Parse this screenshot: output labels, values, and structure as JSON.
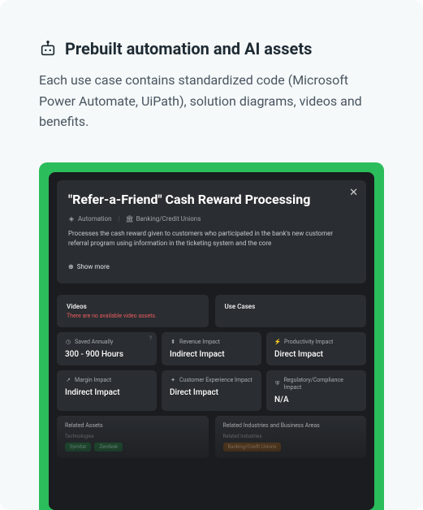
{
  "header": {
    "title": "Prebuilt automation and AI assets",
    "description": "Each use case contains standardized code (Microsoft Power Automate, UiPath), solution diagrams, videos and benefits."
  },
  "panel": {
    "title": "\"Refer-a-Friend\" Cash Reward Processing",
    "meta": {
      "category": "Automation",
      "industry": "Banking/Credit Unions"
    },
    "description": "Processes the cash reward given to customers who participated in the bank's new customer referral program using information in the ticketing system and the core",
    "show_more": "Show more",
    "close": "✕"
  },
  "cards": {
    "videos": {
      "label": "Videos",
      "sub": "There are no available video assets."
    },
    "usecases": {
      "label": "Use Cases"
    }
  },
  "metrics": [
    {
      "label": "Saved Annually",
      "value": "300 - 900 Hours",
      "info": true
    },
    {
      "label": "Revenue Impact",
      "value": "Indirect Impact"
    },
    {
      "label": "Productivity Impact",
      "value": "Direct Impact"
    },
    {
      "label": "Margin Impact",
      "value": "Indirect Impact"
    },
    {
      "label": "Customer Experience Impact",
      "value": "Direct Impact"
    },
    {
      "label": "Regulatory/Compliance Impact",
      "value": "N/A"
    }
  ],
  "bottom": {
    "left": {
      "title": "Related Assets",
      "sub": "Technologies",
      "chips": [
        "Symitar",
        "Zendesk"
      ]
    },
    "right": {
      "title": "Related Industries and Business Areas",
      "sub": "Related Industries",
      "chips": [
        "Banking/Credit Unions"
      ]
    }
  }
}
